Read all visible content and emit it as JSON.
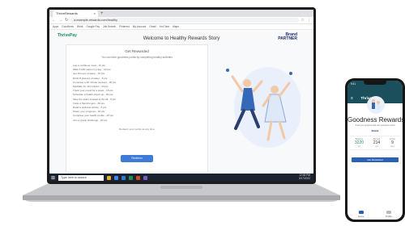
{
  "browser": {
    "tab_title": "ThriveRewards",
    "tab_close": "×",
    "new_tab": "+",
    "url": "a.example-rewards.com/healthy",
    "bookmarks": [
      "Apps",
      "Goodfirms",
      "Work",
      "Google Pay",
      "Job Search",
      "Pinterest",
      "My Account",
      "Gmail",
      "YouTube",
      "Maps"
    ],
    "page_title": "Welcome to Healthy Rewards Story",
    "logo": "ThrivePay",
    "partner_line1": "Brand",
    "partner_line2": "PARTNER",
    "card_heading": "Get Rewarded",
    "card_intro": "You can earn goodness points by completing healthy activities",
    "earn_list": [
      "Log a nutritious meal - 10 pts",
      "Walk 5,000 steps in a day - 20 pts",
      "Get 8 hours of sleep - 15 pts",
      "Drink 8 glasses of water - 5 pts",
      "Complete a 30 minute workout - 25 pts",
      "Meditate for 10 minutes - 10 pts",
      "Track your mood for a week - 15 pts",
      "Schedule a health check-up - 50 pts",
      "Take the stairs instead of the lift - 5 pts",
      "Invite a friend to join - 30 pts",
      "Read a wellness article - 5 pts",
      "Share your progress - 10 pts",
      "Complete your health profile - 40 pts",
      "Join a group challenge - 20 pts"
    ],
    "card_footer": "Redeem your points at any time",
    "redeem_button": "Redeem",
    "search_placeholder": "Type here to search",
    "clock_time": "12:45 PM",
    "clock_date": "3/17/2022"
  },
  "phone": {
    "status_time": "9:41",
    "menu_icon": "≡",
    "logo": "ThrivePay",
    "title": "Goodness Rewards",
    "description": "Track your progress and earn goodness points",
    "partner": "Brand",
    "stats": [
      {
        "label": "Balance",
        "value": "3220",
        "sub": "pts"
      },
      {
        "label": "Earned",
        "value": "214",
        "sub": "pts"
      },
      {
        "label": "Active",
        "value": "9",
        "sub": "days"
      }
    ],
    "cta_label": "Get Rewarded",
    "nav": [
      "Home",
      "Profile"
    ]
  },
  "colors": {
    "accent": "#3d7bd6",
    "brand_green": "#1a8f5b",
    "phone_header": "#1b4f5c"
  }
}
